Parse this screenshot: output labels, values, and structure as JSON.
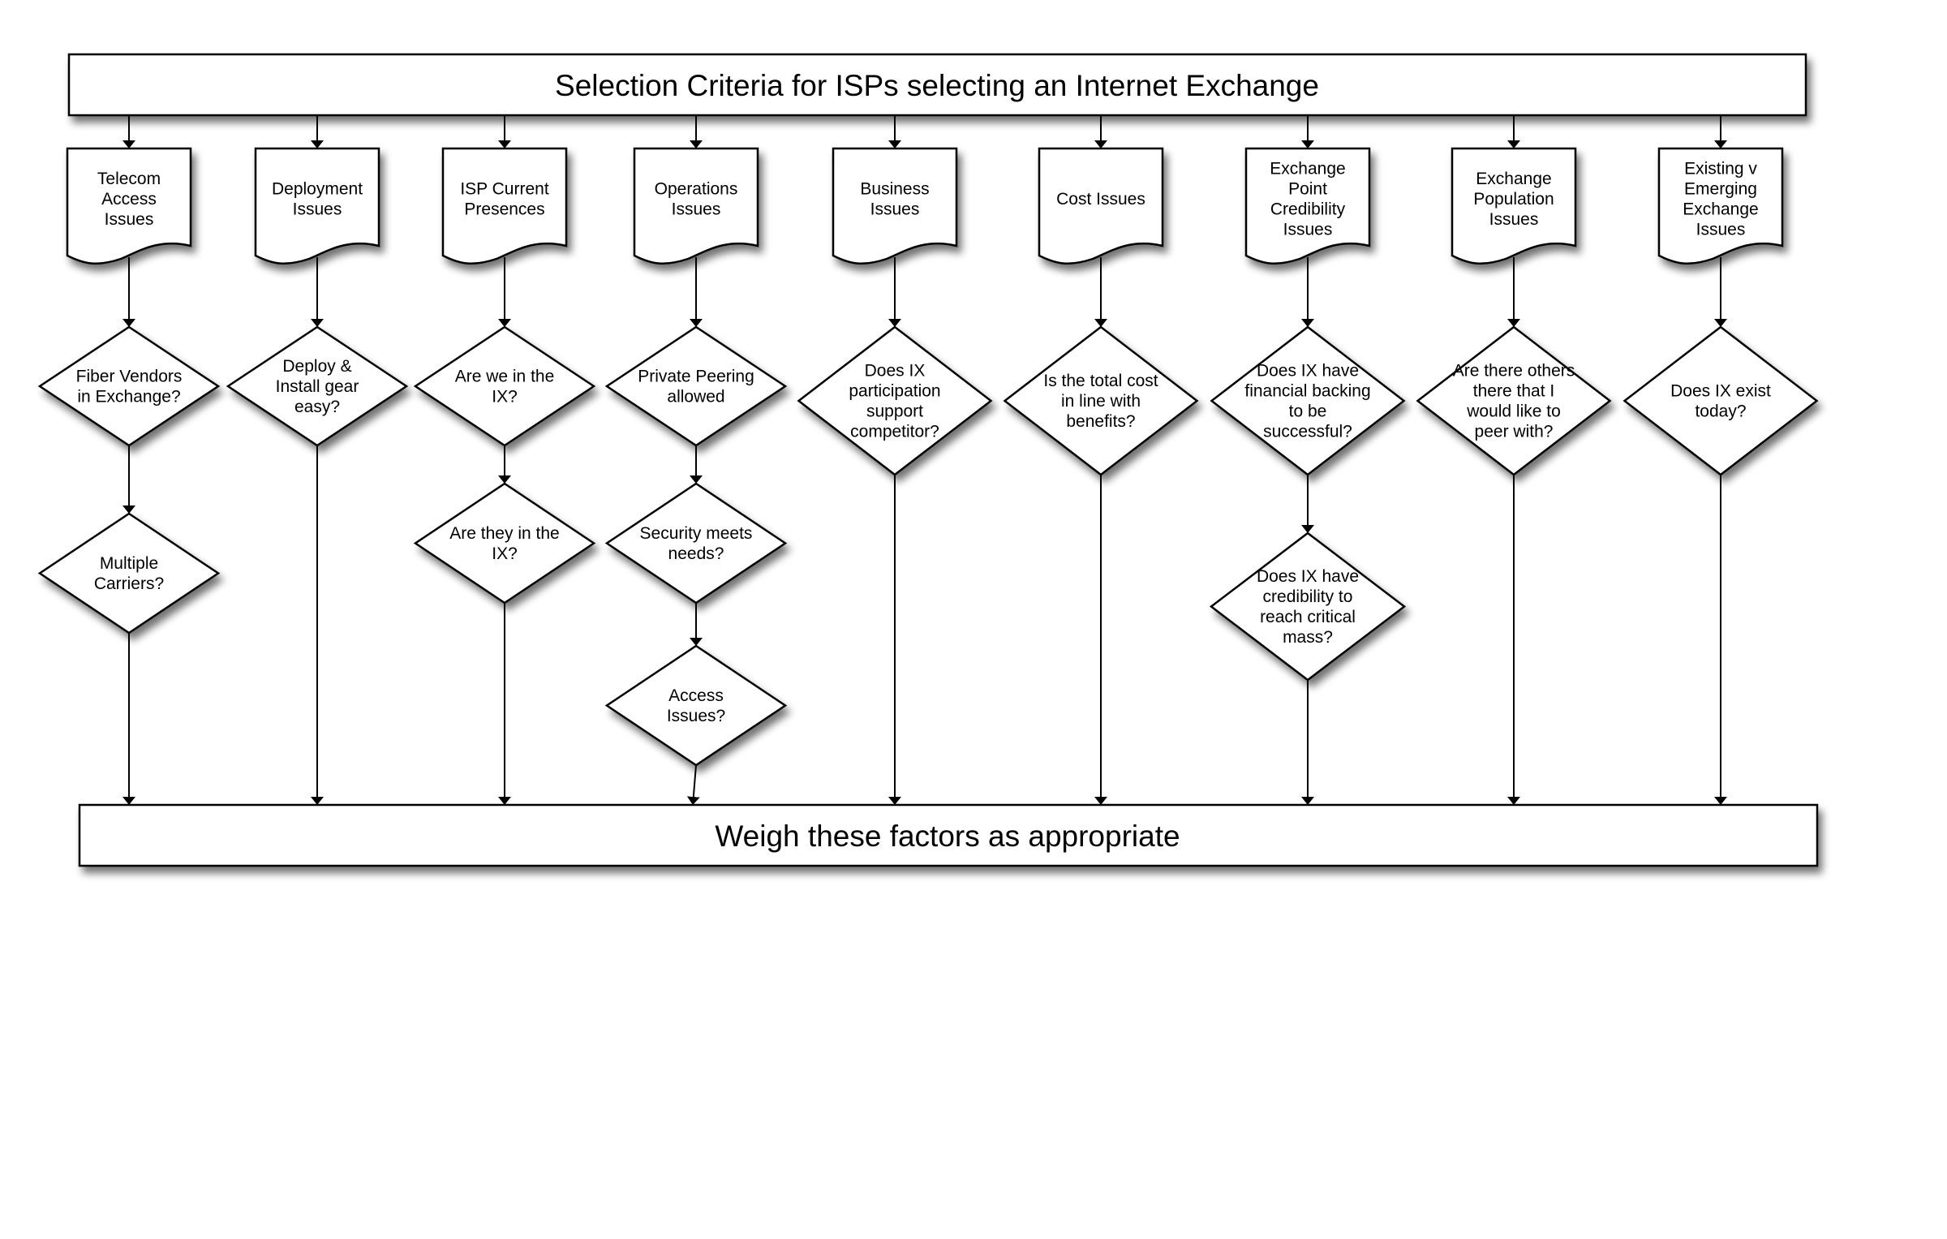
{
  "diagram": {
    "title": "Selection Criteria for ISPs selecting an Internet Exchange",
    "footer": "Weigh these factors as appropriate",
    "colors": {
      "stroke": "#000000",
      "fill": "#ffffff",
      "shadow": "#000000"
    },
    "columns": [
      {
        "category": [
          "Telecom",
          "Access",
          "Issues"
        ],
        "questions": [
          [
            "Fiber Vendors",
            "in Exchange?"
          ],
          [
            "Multiple",
            "Carriers?"
          ]
        ]
      },
      {
        "category": [
          "Deployment",
          "Issues"
        ],
        "questions": [
          [
            "Deploy &",
            "Install gear",
            "easy?"
          ]
        ]
      },
      {
        "category": [
          "ISP Current",
          "Presences"
        ],
        "questions": [
          [
            "Are we in the",
            "IX?"
          ],
          [
            "Are they in the",
            "IX?"
          ]
        ]
      },
      {
        "category": [
          "Operations",
          "Issues"
        ],
        "questions": [
          [
            "Private Peering",
            "allowed"
          ],
          [
            "Security meets",
            "needs?"
          ],
          [
            "Access",
            "Issues?"
          ]
        ]
      },
      {
        "category": [
          "Business",
          "Issues"
        ],
        "questions": [
          [
            "Does IX",
            "participation",
            "support",
            "competitor?"
          ]
        ]
      },
      {
        "category": [
          "Cost Issues"
        ],
        "questions": [
          [
            "Is the total cost",
            "in line with",
            "benefits?"
          ]
        ]
      },
      {
        "category": [
          "Exchange",
          "Point",
          "Credibility",
          "Issues"
        ],
        "questions": [
          [
            "Does IX have",
            "financial backing",
            "to be",
            "successful?"
          ],
          [
            "Does IX have",
            "credibility to",
            "reach critical",
            "mass?"
          ]
        ]
      },
      {
        "category": [
          "Exchange",
          "Population",
          "Issues"
        ],
        "questions": [
          [
            "Are there others",
            "there that I",
            "would like to",
            "peer with?"
          ]
        ]
      },
      {
        "category": [
          "Existing v",
          "Emerging",
          "Exchange",
          "Issues"
        ],
        "questions": [
          [
            "Does IX exist",
            "today?"
          ]
        ]
      }
    ]
  }
}
